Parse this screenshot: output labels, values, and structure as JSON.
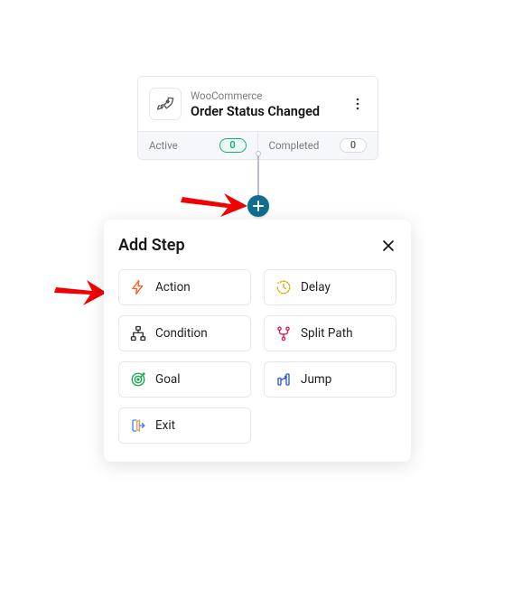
{
  "trigger": {
    "app": "WooCommerce",
    "event": "Order Status Changed",
    "stats": {
      "active_label": "Active",
      "active_count": "0",
      "completed_label": "Completed",
      "completed_count": "0"
    }
  },
  "panel": {
    "title": "Add Step",
    "steps": {
      "action": {
        "label": "Action"
      },
      "delay": {
        "label": "Delay"
      },
      "condition": {
        "label": "Condition"
      },
      "split": {
        "label": "Split Path"
      },
      "goal": {
        "label": "Goal"
      },
      "jump": {
        "label": "Jump"
      },
      "exit": {
        "label": "Exit"
      }
    }
  },
  "colors": {
    "add_btn": "#0f6e8c",
    "arrow": "#f20000",
    "action": "#ff5b1f",
    "delay": "#e0a900",
    "condition": "#2b2b2b",
    "split": "#e11d58",
    "goal": "#18a74e",
    "jump": "#3059d6",
    "exit": "#3b82f6"
  }
}
